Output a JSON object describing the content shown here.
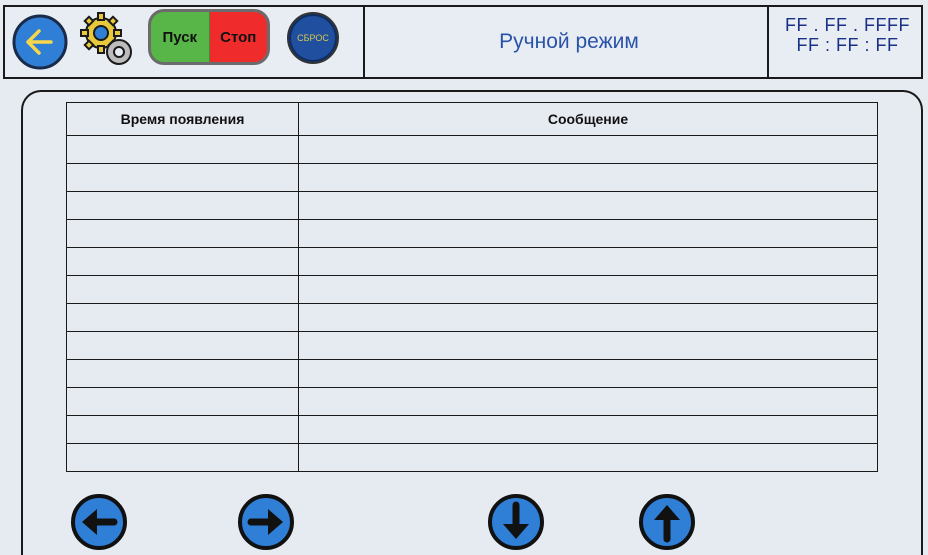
{
  "header": {
    "title": "Ручной режим",
    "clock_date": "FF . FF . FFFF",
    "clock_time": "FF : FF : FF",
    "start_label": "Пуск",
    "stop_label": "Стоп",
    "reset_label": "СБРОС"
  },
  "table": {
    "columns": [
      "Время появления",
      "Сообщение"
    ],
    "rows": [
      [
        "",
        ""
      ],
      [
        "",
        ""
      ],
      [
        "",
        ""
      ],
      [
        "",
        ""
      ],
      [
        "",
        ""
      ],
      [
        "",
        ""
      ],
      [
        "",
        ""
      ],
      [
        "",
        ""
      ],
      [
        "",
        ""
      ],
      [
        "",
        ""
      ],
      [
        "",
        ""
      ],
      [
        "",
        ""
      ]
    ]
  },
  "icons": {
    "back": "back-arrow-icon",
    "settings": "gears-icon",
    "prev": "arrow-left-icon",
    "next": "arrow-right-icon",
    "down": "arrow-down-icon",
    "up": "arrow-up-icon"
  },
  "colors": {
    "accent_blue": "#2f7fd6",
    "start_green": "#58b548",
    "stop_red": "#ef2b2b",
    "reset_blue": "#1f4f9e",
    "title_text": "#2a53a8"
  }
}
